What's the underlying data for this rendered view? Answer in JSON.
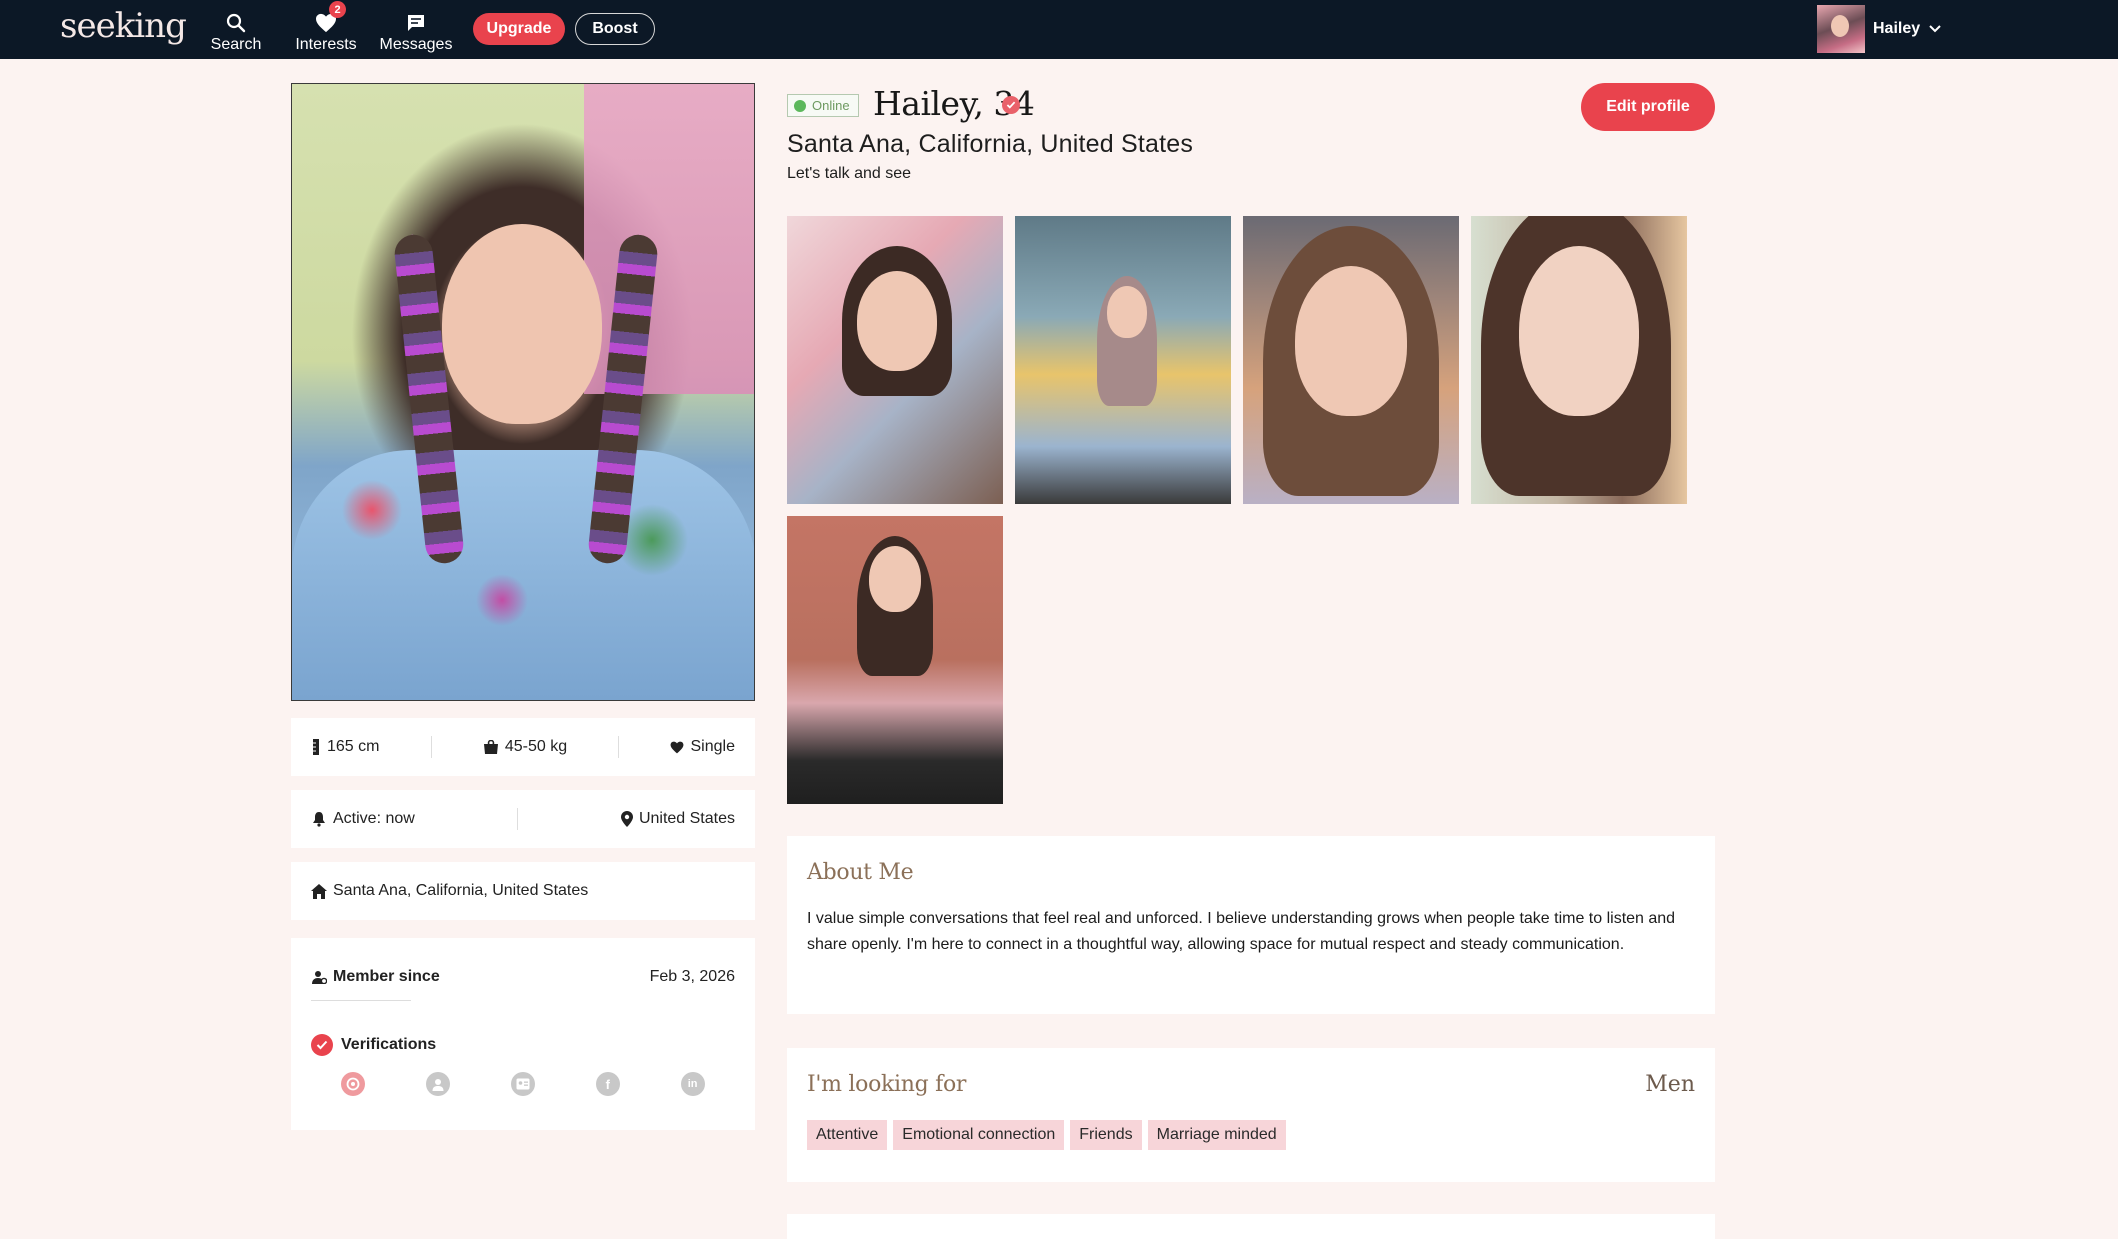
{
  "nav": {
    "logo": "seeking",
    "search_label": "Search",
    "interests_label": "Interests",
    "interests_badge": "2",
    "messages_label": "Messages",
    "upgrade_label": "Upgrade",
    "boost_label": "Boost",
    "user_name": "Hailey"
  },
  "profile": {
    "status": "Online",
    "name_age": "Hailey, 34",
    "location": "Santa Ana, California, United States",
    "tagline": "Let's talk and see",
    "edit_label": "Edit profile"
  },
  "stats": {
    "height": "165 cm",
    "weight": "45-50 kg",
    "relationship": "Single",
    "active": "Active: now",
    "country": "United States",
    "home": "Santa Ana, California, United States"
  },
  "membership": {
    "member_since_label": "Member since",
    "member_since_date": "Feb 3, 2026",
    "verifications_label": "Verifications",
    "verification_icons": [
      "photo-verified-icon",
      "profile-icon",
      "id-card-icon",
      "facebook-icon",
      "linkedin-icon"
    ]
  },
  "about": {
    "title": "About Me",
    "text": "I value simple conversations that feel real and unforced. I believe understanding grows when people take time to listen and share openly. I'm here to connect in a thoughtful way, allowing space for mutual respect and steady communication."
  },
  "looking_for": {
    "title": "I'm looking for",
    "gender": "Men",
    "tags": [
      "Attentive",
      "Emotional connection",
      "Friends",
      "Marriage minded"
    ]
  },
  "colors": {
    "nav_bg": "#0c1826",
    "accent": "#e9434d",
    "page_bg": "#fcf3f1",
    "tag_bg": "#f7d5d9",
    "heading": "#8b7058"
  }
}
